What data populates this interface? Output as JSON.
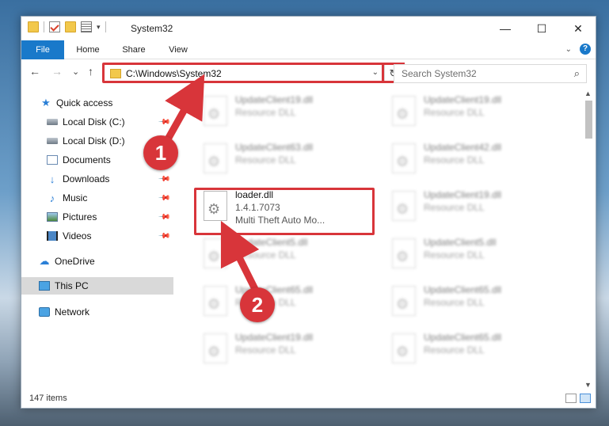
{
  "window": {
    "title": "System32",
    "controls": {
      "minimize": "—",
      "maximize": "☐",
      "close": "✕"
    }
  },
  "ribbon": {
    "tabs": [
      "File",
      "Home",
      "Share",
      "View"
    ],
    "help_label": "?"
  },
  "nav": {
    "back": "←",
    "forward": "→",
    "recent": "⌄",
    "up": "↑",
    "address": "C:\\Windows\\System32",
    "refresh": "↻",
    "search_placeholder": "Search System32"
  },
  "sidebar": {
    "items": [
      {
        "label": "Quick access",
        "icon": "star-icon"
      },
      {
        "label": "Local Disk (C:)",
        "icon": "disk-icon",
        "pinned": true
      },
      {
        "label": "Local Disk (D:)",
        "icon": "disk-icon",
        "pinned": false
      },
      {
        "label": "Documents",
        "icon": "document-icon",
        "pinned": true
      },
      {
        "label": "Downloads",
        "icon": "download-icon",
        "pinned": true
      },
      {
        "label": "Music",
        "icon": "music-icon",
        "pinned": true
      },
      {
        "label": "Pictures",
        "icon": "picture-icon",
        "pinned": true
      },
      {
        "label": "Videos",
        "icon": "video-icon",
        "pinned": true
      },
      {
        "label": "OneDrive",
        "icon": "cloud-icon"
      },
      {
        "label": "This PC",
        "icon": "computer-icon",
        "selected": true
      },
      {
        "label": "Network",
        "icon": "network-icon"
      }
    ]
  },
  "files": {
    "highlighted": {
      "name": "loader.dll",
      "version": "1.4.1.7073",
      "description": "Multi Theft Auto Mo..."
    },
    "blurred": [
      {
        "name": "UpdateClient19.dll",
        "type": "Resource DLL"
      },
      {
        "name": "UpdateClient19.dll",
        "type": "Resource DLL"
      },
      {
        "name": "UpdateClient63.dll",
        "type": "Resource DLL"
      },
      {
        "name": "UpdateClient42.dll",
        "type": "Resource DLL"
      },
      {
        "name": "UpdateClient19.dll",
        "type": "Resource DLL"
      },
      {
        "name": "UpdateClient5.dll",
        "type": "Resource DLL"
      },
      {
        "name": "UpdateClient5.dll",
        "type": "Resource DLL"
      },
      {
        "name": "UpdateClient65.dll",
        "type": "Resource DLL"
      },
      {
        "name": "UpdateClient65.dll",
        "type": "Resource DLL"
      },
      {
        "name": "UpdateClient19.dll",
        "type": "Resource DLL"
      },
      {
        "name": "UpdateClient65.dll",
        "type": "Resource DLL"
      }
    ]
  },
  "status": {
    "item_count": "147 items"
  },
  "annotations": {
    "badge1": "1",
    "badge2": "2",
    "color": "#d8353a"
  }
}
